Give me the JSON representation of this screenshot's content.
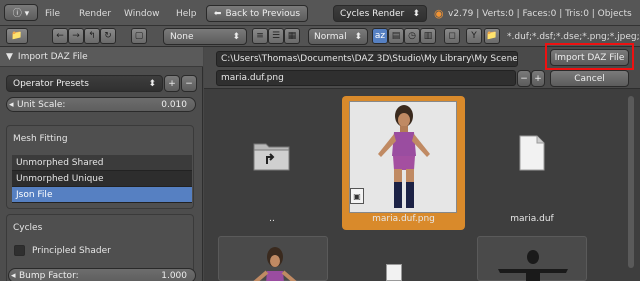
{
  "header": {
    "menus": [
      "File",
      "Render",
      "Window",
      "Help"
    ],
    "back_button": "Back to Previous",
    "engine": "Cycles Render",
    "stats": "v2.79 | Verts:0 | Faces:0 | Tris:0 | Objects",
    "filter_ext": "*.duf;*.dsf;*.dse;*.png;*.jpeg;*.j"
  },
  "toolbar": {
    "display_mode": "None",
    "sort_mode": "Normal"
  },
  "sidebar": {
    "panel_title": "Import DAZ File",
    "operator_presets": "Operator Presets",
    "unit_scale_label": "Unit Scale:",
    "unit_scale_value": "0.010",
    "mesh_fitting_label": "Mesh Fitting",
    "mesh_options": [
      "Unmorphed Shared",
      "Unmorphed Unique",
      "Json File"
    ],
    "cycles_label": "Cycles",
    "principled_shader": "Principled Shader",
    "bump_factor_label": "Bump Factor:",
    "bump_factor_value": "1.000"
  },
  "browser": {
    "path": "C:\\Users\\Thomas\\Documents\\DAZ 3D\\Studio\\My Library\\My Scenes\\",
    "filename": "maria.duf.png",
    "import_button": "Import DAZ File",
    "cancel_button": "Cancel",
    "items": [
      {
        "name": ".."
      },
      {
        "name": "maria.duf.png"
      },
      {
        "name": "maria.duf"
      }
    ],
    "selected_color": "#d98a2b"
  }
}
